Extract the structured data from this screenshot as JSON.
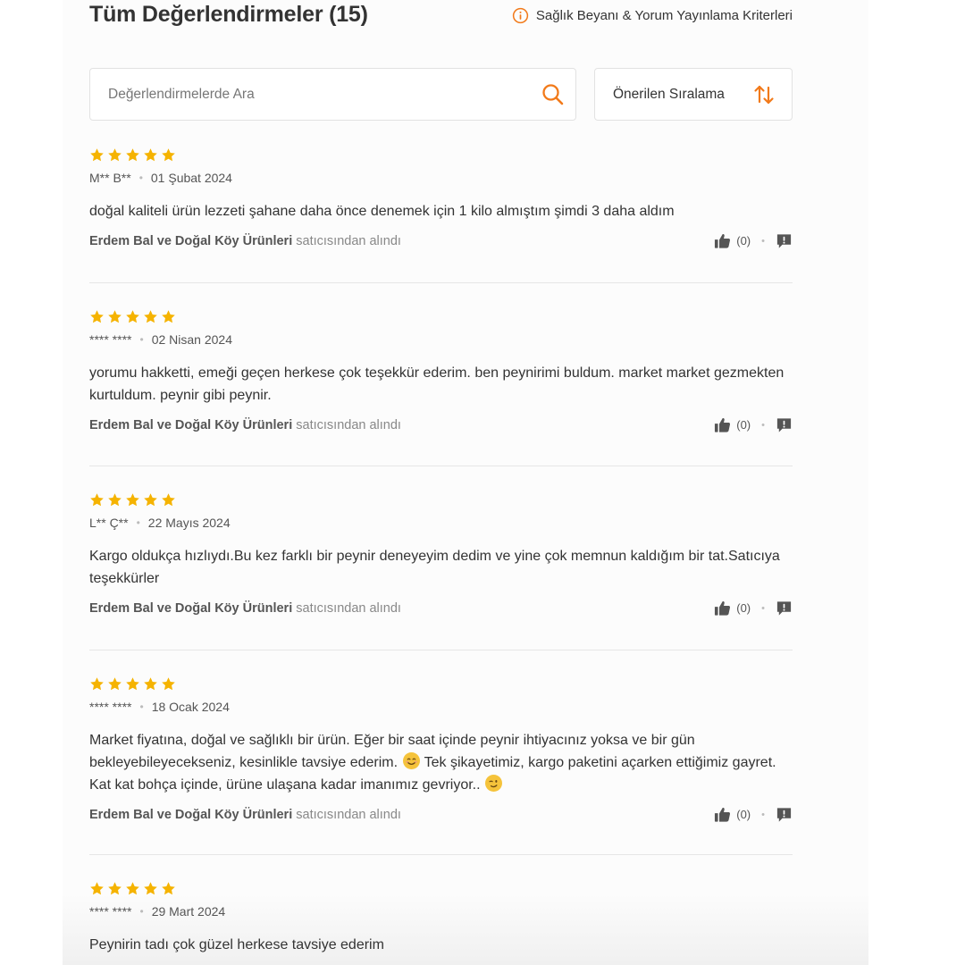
{
  "header": {
    "title": "Tüm Değerlendirmeler (15)",
    "criteria_link": "Sağlık Beyanı & Yorum Yayınlama Kriterleri"
  },
  "search": {
    "placeholder": "Değerlendirmelerde Ara",
    "value": ""
  },
  "sort": {
    "selected": "Önerilen Sıralama"
  },
  "colors": {
    "accent": "#f27a1a",
    "star": "#f5b301",
    "divider": "#e6e6e6"
  },
  "icons": {
    "info": "info-icon",
    "search": "search-icon",
    "sort": "sort-icon",
    "star": "star-icon",
    "like": "thumbs-up-icon",
    "report": "report-icon"
  },
  "reviews": [
    {
      "rating": 5,
      "author": "M** B**",
      "date": "01 Şubat 2024",
      "text": "doğal kaliteli ürün lezzeti şahane daha önce denemek için 1 kilo almıştım şimdi 3 daha aldım",
      "seller": "Erdem Bal ve Doğal Köy Ürünleri",
      "seller_suffix": "satıcısından alındı",
      "likes": "(0)"
    },
    {
      "rating": 5,
      "author": "**** ****",
      "date": "02 Nisan 2024",
      "text": "yorumu hakketti, emeği geçen herkese çok teşekkür ederim. ben peynirimi buldum. market market gezmekten kurtuldum. peynir gibi peynir.",
      "seller": "Erdem Bal ve Doğal Köy Ürünleri",
      "seller_suffix": "satıcısından alındı",
      "likes": "(0)"
    },
    {
      "rating": 5,
      "author": "L** Ç**",
      "date": "22 Mayıs 2024",
      "text": "Kargo oldukça hızlıydı.Bu kez farklı bir peynir deneyeyim dedim ve yine çok memnun kaldığım bir tat.Satıcıya teşekkürler",
      "seller": "Erdem Bal ve Doğal Köy Ürünleri",
      "seller_suffix": "satıcısından alındı",
      "likes": "(0)"
    },
    {
      "rating": 5,
      "author": "**** ****",
      "date": "18 Ocak 2024",
      "text_part1": "Market fiyatına, doğal ve sağlıklı bir ürün. Eğer bir saat içinde peynir ihtiyacınız yoksa ve bir gün bekleyebileyecekseniz, kesinlikle tavsiye ederim.",
      "emoji1": "smiling-face-emoji",
      "text_part2": "Tek şikayetimiz, kargo paketini açarken ettiğimiz gayret. Kat kat bohça içinde, ürüne ulaşana kadar imanımız gevriyor..",
      "emoji2": "winking-face-emoji",
      "seller": "Erdem Bal ve Doğal Köy Ürünleri",
      "seller_suffix": "satıcısından alındı",
      "likes": "(0)"
    },
    {
      "rating": 5,
      "author": "**** ****",
      "date": "29 Mart 2024",
      "text": "Peynirin tadı çok güzel herkese tavsiye ederim"
    }
  ]
}
